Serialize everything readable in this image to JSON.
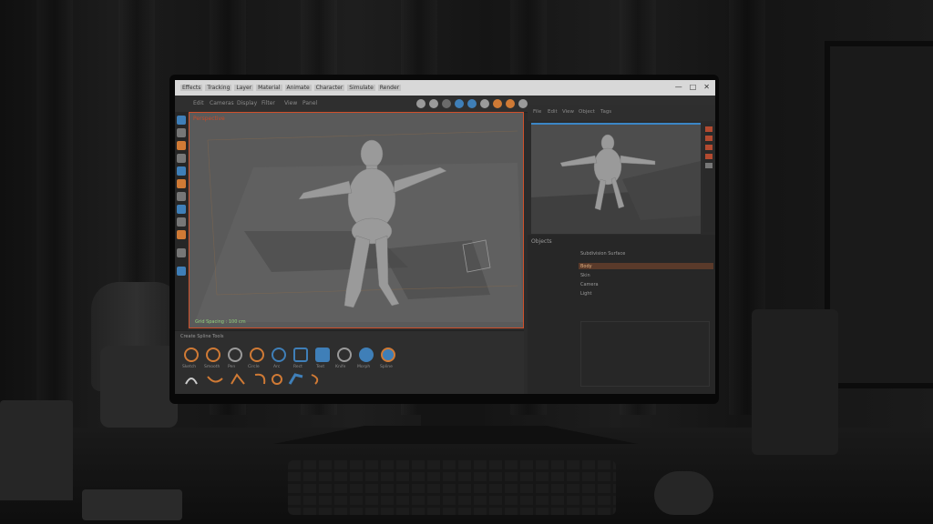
{
  "window": {
    "menu_items": [
      "Effects",
      "Tracking",
      "Layer",
      "Material",
      "Animate",
      "Character",
      "Simulate",
      "Render"
    ],
    "controls": [
      "—",
      "□",
      "✕"
    ]
  },
  "toolbar": {
    "left_texts": [
      "Edit",
      "Cameras",
      "Display",
      "Filter",
      "View",
      "Panel"
    ],
    "icons": [
      "move-icon",
      "rotate-icon",
      "scale-icon",
      "render-icon",
      "render-settings-icon",
      "object-icon",
      "spline-icon",
      "generator-icon",
      "deformer-icon",
      "light-icon"
    ]
  },
  "viewport": {
    "header": "Perspective",
    "status": "Grid Spacing : 100 cm",
    "figure": "human-base-mesh"
  },
  "bottom_panel": {
    "tabs": "Create Spline Tools",
    "tools": [
      {
        "name": "Sketch",
        "color": "#d07a35"
      },
      {
        "name": "Smooth",
        "color": "#d07a35"
      },
      {
        "name": "Pen",
        "color": "#9a9a9a"
      },
      {
        "name": "Circle",
        "color": "#d07a35"
      },
      {
        "name": "Arc",
        "color": "#3f7fb8"
      },
      {
        "name": "Rect",
        "color": "#3f7fb8"
      },
      {
        "name": "Text",
        "color": "#3f7fb8"
      },
      {
        "name": "Knife",
        "color": "#9a9a9a"
      },
      {
        "name": "Morph",
        "color": "#3f7fb8"
      },
      {
        "name": "Spline",
        "color": "#3f7fb8"
      }
    ]
  },
  "right_panel": {
    "toolbar_texts": [
      "File",
      "Edit",
      "View",
      "Object",
      "Tags"
    ],
    "outliner_header": "Objects",
    "outliner_rows": [
      "Subdivision Surface",
      "Body",
      "Skin",
      "Camera",
      "Light"
    ],
    "selected_row_index": 1
  },
  "colors": {
    "accent_orange": "#d0502a",
    "accent_blue": "#3b86c6",
    "status_green": "#8fd07a"
  }
}
